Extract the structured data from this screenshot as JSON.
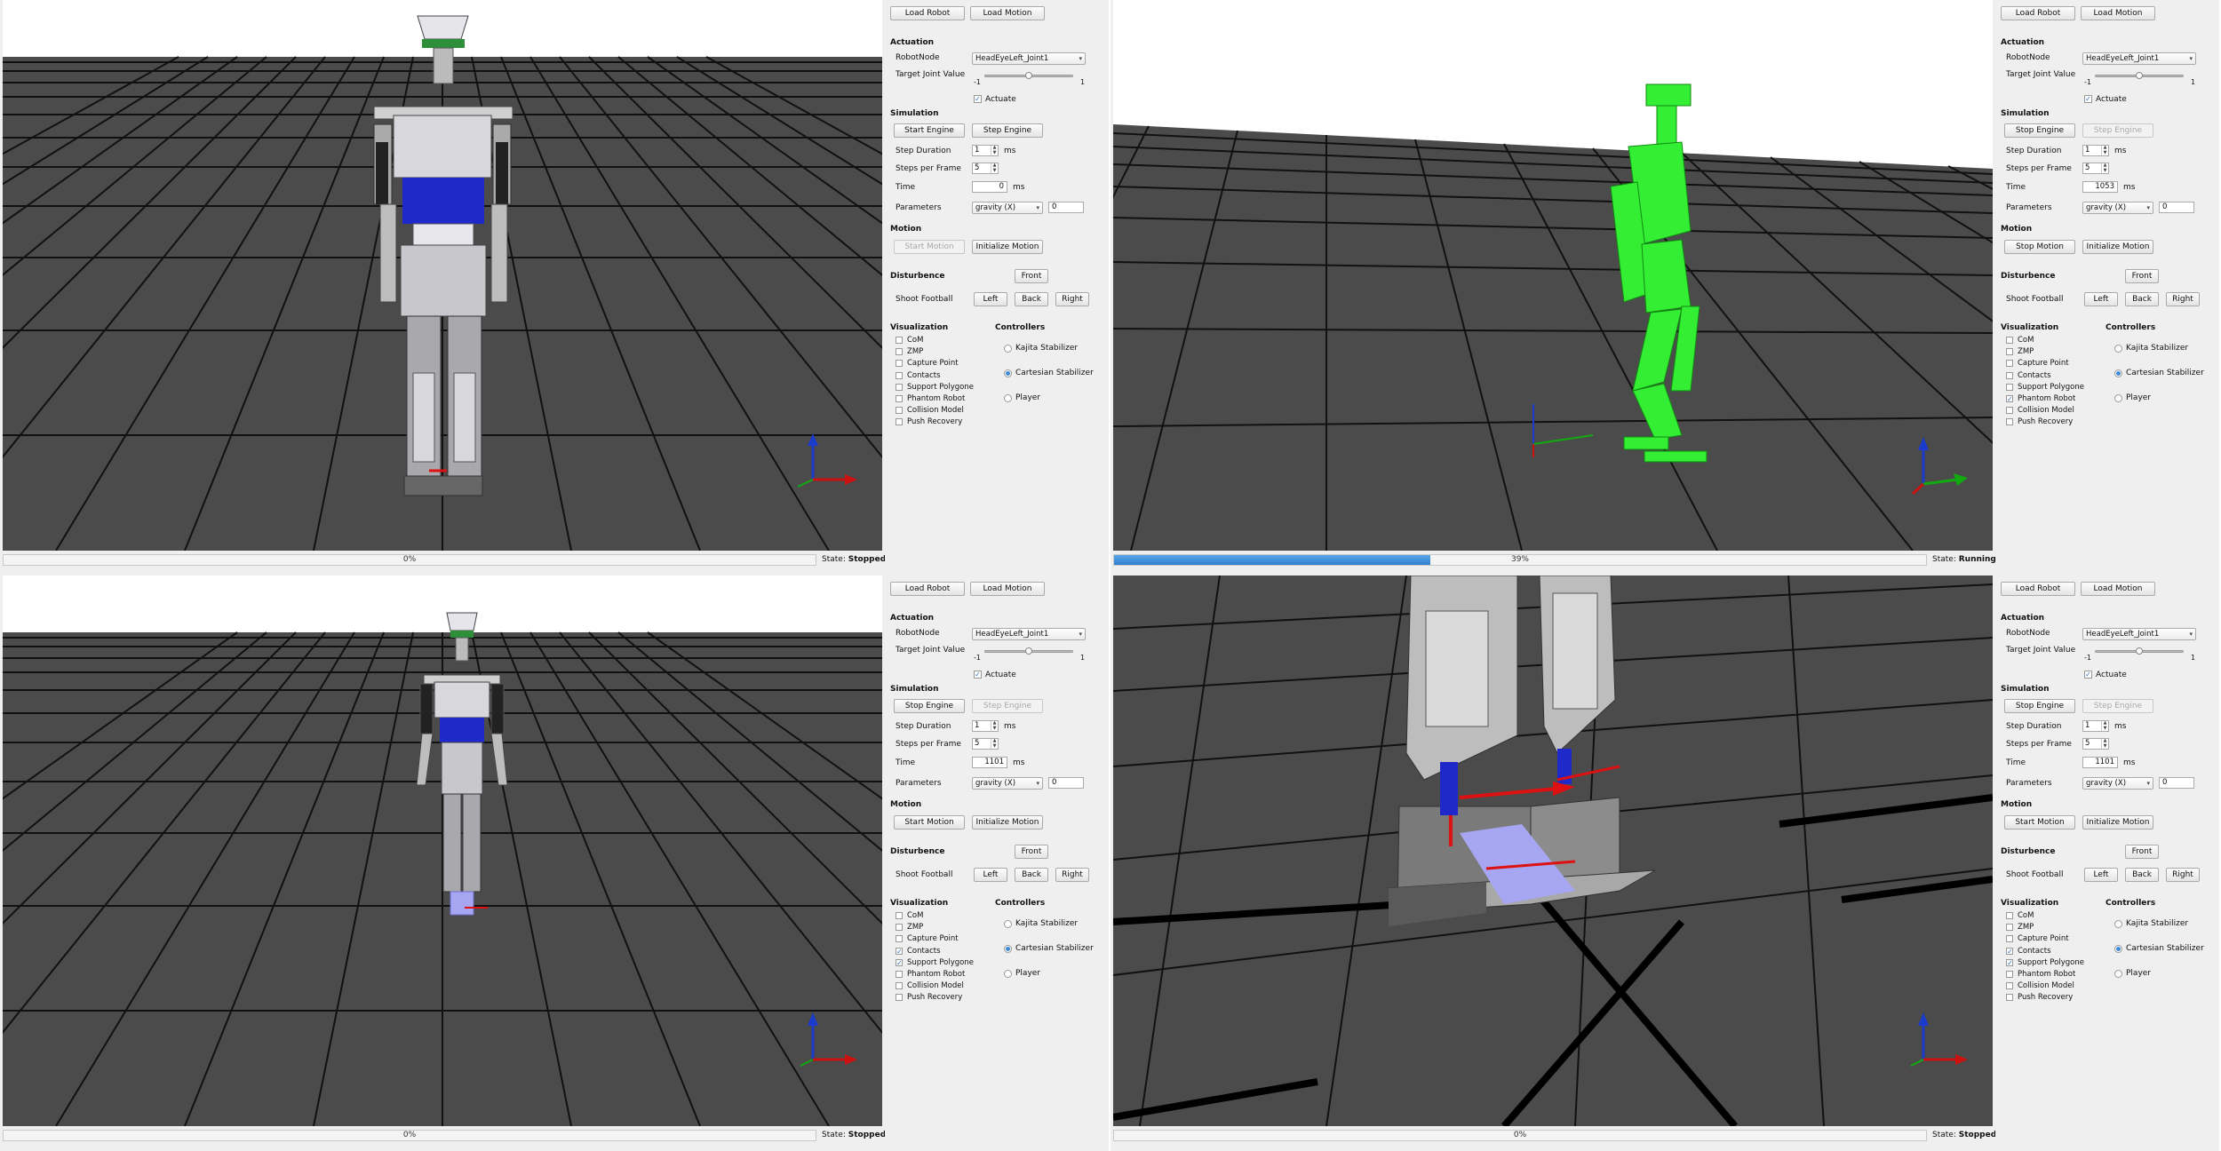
{
  "panels": [
    {
      "buttons": {
        "load_robot": "Load Robot",
        "load_motion": "Load Motion",
        "start_engine": "Start Engine",
        "step_engine": "Step Engine",
        "motion_toggle": "Start Motion",
        "initialize_motion": "Initialize Motion",
        "front": "Front",
        "left": "Left",
        "back": "Back",
        "right": "Right"
      },
      "step_engine_enabled": true,
      "motion_toggle_enabled": false,
      "robot_node": "HeadEyeLeft_Joint1",
      "slider_min": "-1",
      "slider_max": "1",
      "slider_fraction": 0.5,
      "actuate": "Actuate",
      "actuate_checked": true,
      "step_duration": "1",
      "steps_per_frame": "5",
      "time": "0",
      "param_option": "gravity (X)",
      "param_value": "0",
      "visualization": [
        {
          "label": "CoM",
          "checked": false
        },
        {
          "label": "ZMP",
          "checked": false
        },
        {
          "label": "Capture Point",
          "checked": false
        },
        {
          "label": "Contacts",
          "checked": false
        },
        {
          "label": "Support Polygone",
          "checked": false
        },
        {
          "label": "Phantom Robot",
          "checked": false
        },
        {
          "label": "Collision Model",
          "checked": false
        },
        {
          "label": "Push Recovery",
          "checked": false
        }
      ],
      "controllers": [
        {
          "label": "Kajita Stabilizer",
          "selected": false
        },
        {
          "label": "Cartesian Stabilizer",
          "selected": true
        },
        {
          "label": "Player",
          "selected": false
        }
      ],
      "progress_text": "0%",
      "progress_value": 0,
      "state_value": "Stopped"
    },
    {
      "buttons": {
        "load_robot": "Load Robot",
        "load_motion": "Load Motion",
        "start_engine": "Stop Engine",
        "step_engine": "Step Engine",
        "motion_toggle": "Stop Motion",
        "initialize_motion": "Initialize Motion",
        "front": "Front",
        "left": "Left",
        "back": "Back",
        "right": "Right"
      },
      "step_engine_enabled": false,
      "motion_toggle_enabled": true,
      "robot_node": "HeadEyeLeft_Joint1",
      "slider_min": "-1",
      "slider_max": "1",
      "slider_fraction": 0.5,
      "actuate": "Actuate",
      "actuate_checked": true,
      "step_duration": "1",
      "steps_per_frame": "5",
      "time": "1053",
      "param_option": "gravity (X)",
      "param_value": "0",
      "visualization": [
        {
          "label": "CoM",
          "checked": false
        },
        {
          "label": "ZMP",
          "checked": false
        },
        {
          "label": "Capture Point",
          "checked": false
        },
        {
          "label": "Contacts",
          "checked": false
        },
        {
          "label": "Support Polygone",
          "checked": false
        },
        {
          "label": "Phantom Robot",
          "checked": true
        },
        {
          "label": "Collision Model",
          "checked": false
        },
        {
          "label": "Push Recovery",
          "checked": false
        }
      ],
      "controllers": [
        {
          "label": "Kajita Stabilizer",
          "selected": false
        },
        {
          "label": "Cartesian Stabilizer",
          "selected": true
        },
        {
          "label": "Player",
          "selected": false
        }
      ],
      "progress_text": "39%",
      "progress_value": 0.39,
      "state_value": "Running"
    },
    {
      "buttons": {
        "load_robot": "Load Robot",
        "load_motion": "Load Motion",
        "start_engine": "Stop Engine",
        "step_engine": "Step Engine",
        "motion_toggle": "Start Motion",
        "initialize_motion": "Initialize Motion",
        "front": "Front",
        "left": "Left",
        "back": "Back",
        "right": "Right"
      },
      "step_engine_enabled": false,
      "motion_toggle_enabled": true,
      "robot_node": "HeadEyeLeft_Joint1",
      "slider_min": "-1",
      "slider_max": "1",
      "slider_fraction": 0.5,
      "actuate": "Actuate",
      "actuate_checked": true,
      "step_duration": "1",
      "steps_per_frame": "5",
      "time": "1101",
      "param_option": "gravity (X)",
      "param_value": "0",
      "visualization": [
        {
          "label": "CoM",
          "checked": false
        },
        {
          "label": "ZMP",
          "checked": false
        },
        {
          "label": "Capture Point",
          "checked": false
        },
        {
          "label": "Contacts",
          "checked": true
        },
        {
          "label": "Support Polygone",
          "checked": true
        },
        {
          "label": "Phantom Robot",
          "checked": false
        },
        {
          "label": "Collision Model",
          "checked": false
        },
        {
          "label": "Push Recovery",
          "checked": false
        }
      ],
      "controllers": [
        {
          "label": "Kajita Stabilizer",
          "selected": false
        },
        {
          "label": "Cartesian Stabilizer",
          "selected": true
        },
        {
          "label": "Player",
          "selected": false
        }
      ],
      "progress_text": "0%",
      "progress_value": 0,
      "state_value": "Stopped"
    },
    {
      "buttons": {
        "load_robot": "Load Robot",
        "load_motion": "Load Motion",
        "start_engine": "Stop Engine",
        "step_engine": "Step Engine",
        "motion_toggle": "Start Motion",
        "initialize_motion": "Initialize Motion",
        "front": "Front",
        "left": "Left",
        "back": "Back",
        "right": "Right"
      },
      "step_engine_enabled": false,
      "motion_toggle_enabled": true,
      "robot_node": "HeadEyeLeft_Joint1",
      "slider_min": "-1",
      "slider_max": "1",
      "slider_fraction": 0.5,
      "actuate": "Actuate",
      "actuate_checked": true,
      "step_duration": "1",
      "steps_per_frame": "5",
      "time": "1101",
      "param_option": "gravity (X)",
      "param_value": "0",
      "visualization": [
        {
          "label": "CoM",
          "checked": false
        },
        {
          "label": "ZMP",
          "checked": false
        },
        {
          "label": "Capture Point",
          "checked": false
        },
        {
          "label": "Contacts",
          "checked": true
        },
        {
          "label": "Support Polygone",
          "checked": true
        },
        {
          "label": "Phantom Robot",
          "checked": false
        },
        {
          "label": "Collision Model",
          "checked": false
        },
        {
          "label": "Push Recovery",
          "checked": false
        }
      ],
      "controllers": [
        {
          "label": "Kajita Stabilizer",
          "selected": false
        },
        {
          "label": "Cartesian Stabilizer",
          "selected": true
        },
        {
          "label": "Player",
          "selected": false
        }
      ],
      "progress_text": "0%",
      "progress_value": 0,
      "state_value": "Stopped"
    }
  ],
  "labels": {
    "actuation": "Actuation",
    "robot_node": "RobotNode",
    "target_joint_value": "Target Joint Value",
    "simulation": "Simulation",
    "step_duration": "Step Duration",
    "steps_per_frame": "Steps per Frame",
    "time": "Time",
    "parameters": "Parameters",
    "ms": "ms",
    "motion": "Motion",
    "disturbence": "Disturbence",
    "shoot_football": "Shoot Football",
    "visualization": "Visualization",
    "controllers": "Controllers",
    "state": "State:"
  },
  "colors": {
    "floor": "#4a4a4a",
    "grid": "#151515",
    "phantom": "#33ee33",
    "support_polygon": "#a6a6f2",
    "progress": "#2f7fd0"
  }
}
